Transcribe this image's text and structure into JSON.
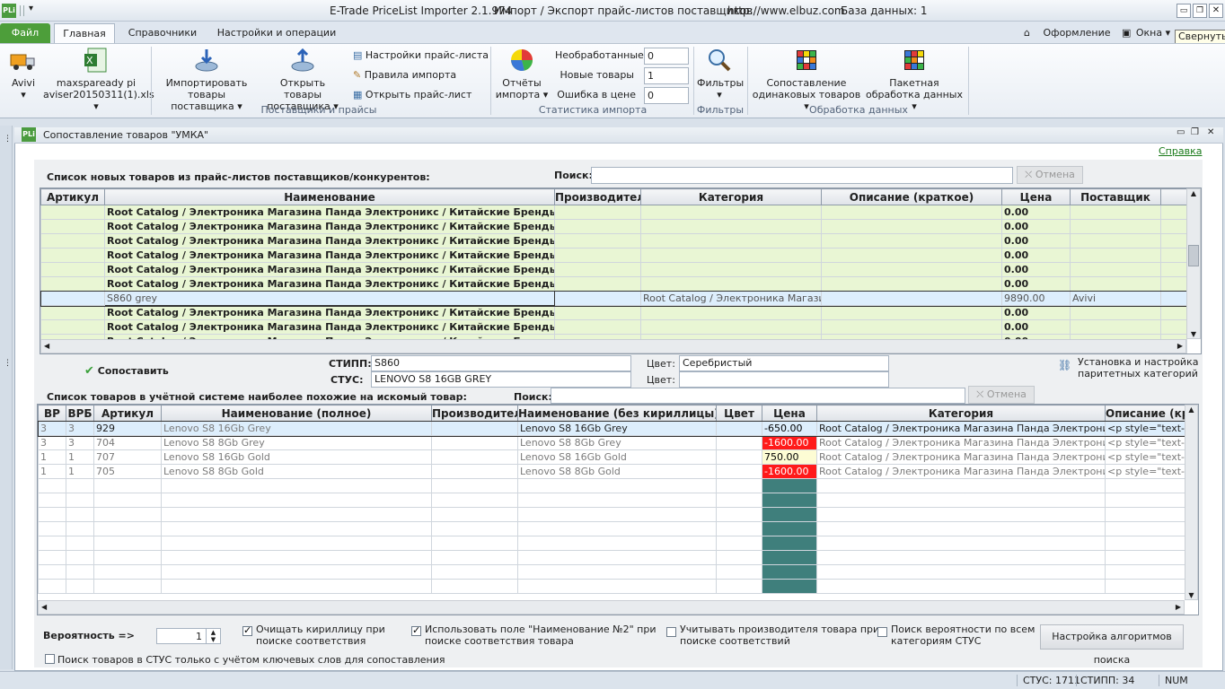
{
  "app": {
    "title": "E-Trade PriceList Importer 2.1.974",
    "subtitle": "Импорт / Экспорт прайс-листов поставщиков",
    "url": "http://www.elbuz.com",
    "db": "База данных: 1",
    "logo": "PLi"
  },
  "tabs": {
    "file": "Файл",
    "main": "Главная",
    "ref": "Справочники",
    "settings": "Настройки и операции",
    "design": "Оформление",
    "window": "Окна",
    "tooltip": "Свернуть"
  },
  "ribbon": {
    "avivi": "Avivi",
    "file1": "maxspaready pi",
    "file2": "aviser20150311(1).xls",
    "import1": "Импортировать",
    "import2": "товары поставщика",
    "open1": "Открыть товары",
    "open2": "поставщика",
    "s1": "Настройки прайс-листа",
    "s2": "Правила импорта",
    "s3": "Открыть прайс-лист",
    "grp1": "Поставщики и прайсы",
    "rep1": "Отчёты",
    "rep2": "импорта",
    "st1": "Необработанные",
    "st1v": "0",
    "st2": "Новые товары",
    "st2v": "1",
    "st3": "Ошибка в цене",
    "st3v": "0",
    "grp2": "Статистика импорта",
    "flt": "Фильтры",
    "grp3": "Фильтры",
    "cmp1": "Сопоставление",
    "cmp2": "одинаковых товаров",
    "batch1": "Пакетная",
    "batch2": "обработка данных",
    "grp4": "Обработка данных"
  },
  "window": {
    "title": "Сопоставление товаров \"УМКА\"",
    "help": "Справка"
  },
  "top": {
    "label": "Список новых товаров из прайс-листов поставщиков/конкурентов:",
    "search": "Поиск:",
    "cancel": "Отмена",
    "headers": [
      "Артикул",
      "Наименование",
      "Производитель",
      "Категория",
      "Описание (краткое)",
      "Цена",
      "Поставщик"
    ],
    "rows": [
      [
        "",
        "Root Catalog / Электроника Магазина Панда Электроникс / Китайские Бренды / Asus",
        "",
        "",
        "",
        "0.00",
        ""
      ],
      [
        "",
        "Root Catalog / Электроника Магазина Панда Электроникс / Китайские Бренды / Huaw",
        "",
        "",
        "",
        "0.00",
        ""
      ],
      [
        "",
        "Root Catalog / Электроника Магазина Панда Электроникс / Китайские Бренды / Huaw",
        "",
        "",
        "",
        "0.00",
        ""
      ],
      [
        "",
        "Root Catalog / Электроника Магазина Панда Электроникс / Китайские Бренды / Huaw",
        "",
        "",
        "",
        "0.00",
        ""
      ],
      [
        "",
        "Root Catalog / Электроника Магазина Панда Электроникс / Китайские Бренды / Leno",
        "",
        "",
        "",
        "0.00",
        ""
      ],
      [
        "",
        "Root Catalog / Электроника Магазина Панда Электроникс / Китайские Бренды / Leno",
        "",
        "",
        "",
        "0.00",
        ""
      ],
      [
        "",
        "S860 grey",
        "",
        "Root Catalog / Электроника Магазина П",
        "",
        "9890.00",
        "Avivi"
      ],
      [
        "",
        "Root Catalog / Электроника Магазина Панда Электроникс / Китайские Бренды / Leno",
        "",
        "",
        "",
        "0.00",
        ""
      ],
      [
        "",
        "Root Catalog / Электроника Магазина Панда Электроникс / Китайские Бренды / Leno",
        "",
        "",
        "",
        "0.00",
        ""
      ],
      [
        "",
        "Root Catalog / Электроника Магазина Панда Электроникс / Китайские Бренды / Leno",
        "",
        "",
        "",
        "0.00",
        ""
      ]
    ]
  },
  "mid": {
    "match": "Сопоставить",
    "stipp": "СТИПП:",
    "stipp_v": "S860",
    "stus": "СТУС:",
    "stus_v": "LENOVO S8 16GB GREY",
    "color": "Цвет:",
    "color_v": "Серебристый",
    "color2": "Цвет:",
    "color2_v": "",
    "install1": "Установка и настройка",
    "install2": "паритетных категорий"
  },
  "bottom": {
    "label": "Список товаров в учётной системе наиболее похожие на искомый товар:",
    "search": "Поиск:",
    "cancel": "Отмена",
    "headers": [
      "ВР",
      "ВРБ",
      "Артикул",
      "Наименование (полное)",
      "Производитель",
      "Наименование (без кириллицы)",
      "Цвет",
      "Цена",
      "Категория",
      "Описание (кра"
    ],
    "rows": [
      [
        "3",
        "3",
        "929",
        "Lenovo S8 16Gb Grey",
        "",
        "Lenovo S8 16Gb Grey",
        "",
        "-650.00",
        "Root Catalog / Электроника Магазина Панда Электроникс",
        "<p style=\"text-ali"
      ],
      [
        "3",
        "3",
        "704",
        "Lenovo S8 8Gb Grey",
        "",
        "Lenovo S8 8Gb Grey",
        "",
        "-1600.00",
        "Root Catalog / Электроника Магазина Панда Электроникс",
        "<p style=\"text-ali"
      ],
      [
        "1",
        "1",
        "707",
        "Lenovo S8 16Gb Gold",
        "",
        "Lenovo S8 16Gb Gold",
        "",
        "750.00",
        "Root Catalog / Электроника Магазина Панда Электроникс",
        "<p style=\"text-ali"
      ],
      [
        "1",
        "1",
        "705",
        "Lenovo S8 8Gb Gold",
        "",
        "Lenovo S8 8Gb Gold",
        "",
        "-1600.00",
        "Root Catalog / Электроника Магазина Панда Электроникс",
        "<p style=\"text-ali"
      ]
    ]
  },
  "options": {
    "prob": "Вероятность =>",
    "prob_v": "1",
    "o1a": "Очищать кириллицу при",
    "o1b": "поиске соответствия",
    "o2a": "Использовать поле \"Наименование №2\" при",
    "o2b": "поиске соответствия товара",
    "o3a": "Учитывать производителя товара при",
    "o3b": "поиске соответствий",
    "o4a": "Поиск вероятности по всем",
    "o4b": "категориям СТУС",
    "algo": "Настройка алгоритмов поиска",
    "kw": "Поиск товаров в СТУС только с учётом ключевых слов для сопоставления"
  },
  "status": {
    "stus": "СТУС: 1711",
    "stipp": "СТИПП: 34",
    "num": "NUM"
  },
  "colors": {
    "accent": "#5aa73d",
    "negative": "#ff1a1a",
    "teal": "#3f7f7c",
    "pos": "#fdfcd4"
  }
}
